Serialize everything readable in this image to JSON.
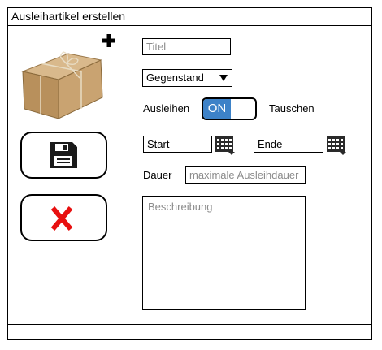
{
  "window": {
    "title": "Ausleihartikel erstellen"
  },
  "form": {
    "title_placeholder": "Titel",
    "category": {
      "selected": "Gegenstand"
    },
    "mode": {
      "left_label": "Ausleihen",
      "toggle_state": "ON",
      "right_label": "Tauschen"
    },
    "start": {
      "value": "Start"
    },
    "end": {
      "value": "Ende"
    },
    "duration": {
      "label": "Dauer",
      "placeholder": "maximale Ausleihdauer"
    },
    "description": {
      "placeholder": "Beschreibung"
    }
  },
  "icons": {
    "add": "plus-icon",
    "calendar": "calendar-icon",
    "save": "floppy-disk-icon",
    "cancel": "x-icon",
    "dropdown": "triangle-down-icon"
  },
  "colors": {
    "toggle_on": "#3d82c8",
    "cancel": "#e81010",
    "placeholder": "#8c8c8c"
  }
}
